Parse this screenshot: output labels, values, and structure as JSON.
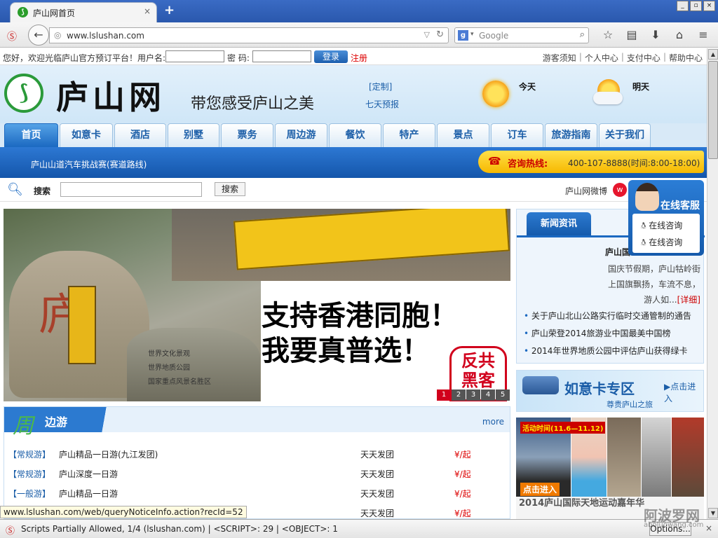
{
  "browser": {
    "tab_title": "庐山网首页",
    "tab_close": "×",
    "new_tab": "+",
    "window_buttons": [
      "_",
      "▫",
      "×"
    ],
    "url": "www.lslushan.com",
    "search_engine": "Google",
    "search_engine_icon": "g-icon",
    "toolbar_icons": [
      "star-icon",
      "reading-list-icon",
      "download-icon",
      "home-icon",
      "menu-icon"
    ]
  },
  "login_bar": {
    "welcome": "您好，欢迎光临庐山官方预订平台！用户名:",
    "password_label": "密 码:",
    "login_button": "登录",
    "register": "注册",
    "links": [
      "游客须知",
      "个人中心",
      "支付中心",
      "帮助中心"
    ],
    "separator": "|"
  },
  "header": {
    "logo_text": "庐山网",
    "slogan": "带您感受庐山之美",
    "custom_link": "[定制]",
    "seven_day": "七天预报",
    "today": "今天",
    "tomorrow": "明天"
  },
  "nav": {
    "items": [
      "首页",
      "如意卡",
      "酒店",
      "别墅",
      "票务",
      "周边游",
      "餐饮",
      "特产",
      "景点",
      "订车",
      "旅游指南",
      "关于我们"
    ],
    "active_index": 0
  },
  "bluebar": {
    "marquee": "庐山山道汽车挑战赛(赛道路线)",
    "hotline_label": "咨询热线:",
    "hotline_number": "400-107-8888(时间:8:00-18:00)"
  },
  "search": {
    "label": "搜索",
    "button": "搜索",
    "weibo": "庐山网微博"
  },
  "online_service": {
    "title": "在线客服",
    "items": [
      "在线咨询",
      "在线咨询"
    ]
  },
  "banner": {
    "rock_char": "庐",
    "rock_text": [
      "世界文化景观",
      "世界地质公园",
      "国家重点风景名胜区"
    ],
    "headline_1": "支持香港同胞！",
    "headline_2": "我要真普选！",
    "stamp_line1": "反共",
    "stamp_line2": "黑客",
    "pages": [
      "1",
      "2",
      "3",
      "4",
      "5"
    ],
    "active_page": 0
  },
  "news": {
    "tab": "新闻资讯",
    "featured_title": "庐山国",
    "featured_summary": "国庆节假期，庐山牯岭街上国旗飘扬，车流不息，游人如...",
    "more": "[详细]",
    "items": [
      "关于庐山北山公路实行临时交通管制的通告",
      "庐山荣登2014旅游业中国最美中国榜",
      "2014年世界地质公园中评估庐山获得绿卡"
    ]
  },
  "tour": {
    "char": "周",
    "title": "边游",
    "more": "more",
    "rows": [
      {
        "tag": "【常规游】",
        "name": "庐山精品一日游(九江发团)",
        "departure": "天天发团",
        "price": "¥/起"
      },
      {
        "tag": "【常规游】",
        "name": "庐山深度一日游",
        "departure": "天天发团",
        "price": "¥/起"
      },
      {
        "tag": "【一般游】",
        "name": "庐山精品一日游",
        "departure": "天天发团",
        "price": "¥/起"
      },
      {
        "tag": "",
        "name": "",
        "departure": "天天发团",
        "price": "¥/起"
      }
    ]
  },
  "ads": {
    "ruyi_title": "如意卡专区",
    "ruyi_enter": "▶点击进入",
    "ruyi_sub": "尊贵庐山之旅",
    "sports_date": "活动时间(11.6—11.12)",
    "sports_enter": "点击进入",
    "sports_caption": "2014庐山国际天地运动嘉年华"
  },
  "status_link": "www.lslushan.com/web/queryNoticeInfo.action?recId=52",
  "statusbar": {
    "text": "Scripts Partially Allowed, 1/4 (lslushan.com) | <SCRIPT>: 29 | <OBJECT>: 1",
    "options": "Options...",
    "close": "×"
  },
  "watermark": {
    "main": "阿波罗网",
    "sub": "aboluowang.com"
  },
  "colors": {
    "brand_blue": "#1b69c1",
    "hotline_yellow": "#f6b800",
    "accent_red": "#d1001c",
    "logo_green": "#2b9a3a"
  }
}
